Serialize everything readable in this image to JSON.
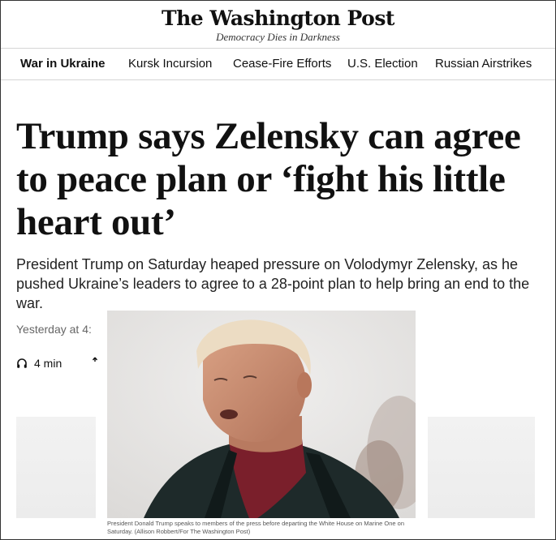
{
  "masthead": {
    "logo": "The Washington Post",
    "tagline": "Democracy Dies in Darkness"
  },
  "nav": {
    "items": [
      {
        "label": "War in Ukraine",
        "active": true
      },
      {
        "label": "Kursk Incursion",
        "active": false
      },
      {
        "label": "Cease-Fire Efforts",
        "active": false
      },
      {
        "label": "U.S. Election",
        "active": false
      },
      {
        "label": "Russian Airstrikes",
        "active": false
      }
    ]
  },
  "article": {
    "headline": "Trump says Zelensky can agree to peace plan or ‘fight his little heart out’",
    "dek": "President Trump on Saturday heaped pressure on Volodymyr Zelensky, as he pushed Ukraine’s leaders to agree to a 28-point plan to help bring an end to the war.",
    "timestamp": "Yesterday at 4:",
    "listen_label": "4 min",
    "listen_icon": "headphones-icon",
    "share_icon": "share-icon"
  },
  "photo": {
    "caption": "President Donald Trump speaks to members of the press before departing the White House on Marine One on Saturday. (Allison Robbert/For The Washington Post)",
    "colors": {
      "background": "#e9e8e7",
      "coat": "#1e2a2a",
      "scarf": "#7a1f2b",
      "hair": "#e9d8bf",
      "skin": "#c98b6c"
    }
  }
}
